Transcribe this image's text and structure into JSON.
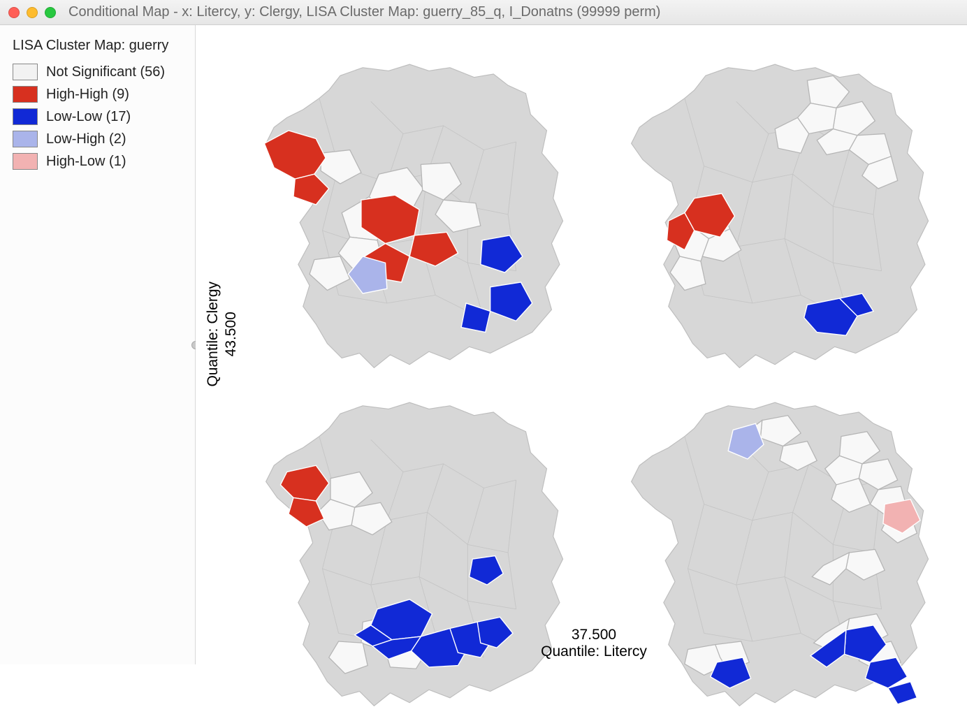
{
  "window": {
    "title": "Conditional Map - x: Litercy, y: Clergy,  LISA Cluster Map: guerry_85_q, I_Donatns (99999 perm)"
  },
  "legend": {
    "title": "LISA Cluster Map: guerry",
    "items": [
      {
        "label": "Not Significant (56)",
        "color": "#f2f2f2"
      },
      {
        "label": "High-High (9)",
        "color": "#d7301f"
      },
      {
        "label": "Low-Low (17)",
        "color": "#1129d6"
      },
      {
        "label": "Low-High (2)",
        "color": "#aab4ea"
      },
      {
        "label": "High-Low (1)",
        "color": "#f2b2b2"
      }
    ]
  },
  "axes": {
    "y_label": "Quantile: Clergy",
    "y_break": "43.500",
    "x_label": "Quantile: Litercy",
    "x_break": "37.500"
  },
  "colors": {
    "base": "#d7d7d7",
    "not_significant": "#f2f2f2",
    "high_high": "#d7301f",
    "low_low": "#1129d6",
    "low_high": "#aab4ea",
    "high_low": "#f2b2b2"
  }
}
